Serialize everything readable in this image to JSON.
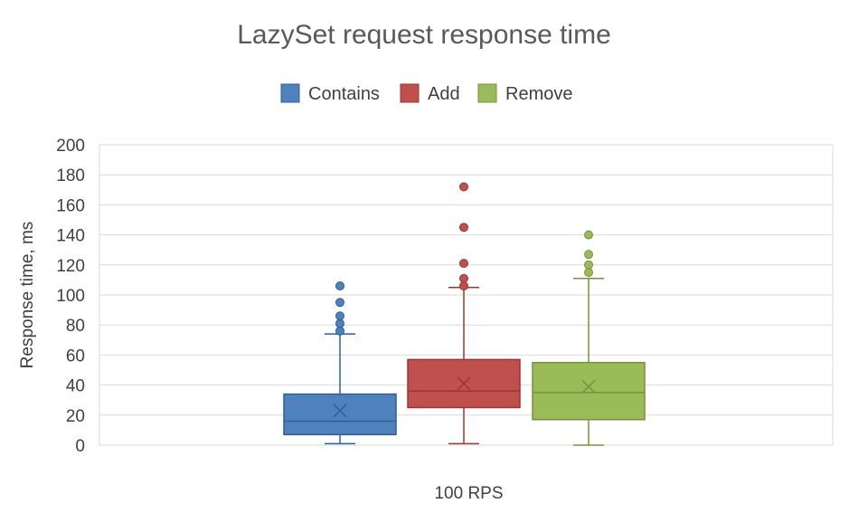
{
  "chart_data": {
    "type": "box",
    "title": "LazySet request response time",
    "ylabel": "Response time, ms",
    "xlabel": "",
    "categories": [
      "100 RPS"
    ],
    "ylim": [
      0,
      200
    ],
    "yticks": [
      0,
      20,
      40,
      60,
      80,
      100,
      120,
      140,
      160,
      180,
      200
    ],
    "grid": true,
    "legend_position": "top",
    "series": [
      {
        "name": "Contains",
        "color": "#4F81BD",
        "border": "#2F5F98",
        "min": 1,
        "q1": 7,
        "median": 16,
        "q3": 34,
        "max": 74,
        "mean": 23,
        "outliers": [
          76,
          81,
          86,
          95,
          106
        ]
      },
      {
        "name": "Add",
        "color": "#C0504D",
        "border": "#9C3533",
        "min": 1,
        "q1": 25,
        "median": 36,
        "q3": 57,
        "max": 105,
        "mean": 41,
        "outliers": [
          106,
          111,
          121,
          145,
          172
        ]
      },
      {
        "name": "Remove",
        "color": "#9BBB59",
        "border": "#76923C",
        "min": 0,
        "q1": 17,
        "median": 35,
        "q3": 55,
        "max": 111,
        "mean": 39,
        "outliers": [
          115,
          120,
          127,
          140
        ]
      }
    ]
  }
}
